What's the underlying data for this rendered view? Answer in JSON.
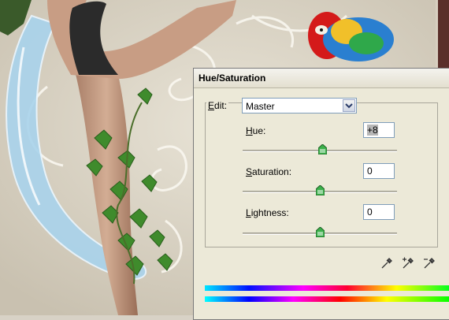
{
  "dialog": {
    "title": "Hue/Saturation",
    "edit": {
      "label_prefix": "",
      "label_hotkey": "E",
      "label_rest": "dit:",
      "selected": "Master"
    },
    "fields": [
      {
        "key": "hue",
        "hotkey": "H",
        "rest": "ue:",
        "value": "+8",
        "slider_fraction": 0.52
      },
      {
        "key": "saturation",
        "hotkey": "S",
        "rest": "aturation:",
        "value": "0",
        "slider_fraction": 0.5
      },
      {
        "key": "lightness",
        "hotkey": "L",
        "rest": "ightness:",
        "value": "0",
        "slider_fraction": 0.5
      }
    ],
    "eyedroppers": [
      "eyedropper-icon",
      "eyedropper-plus-icon",
      "eyedropper-minus-icon"
    ]
  },
  "colors": {
    "slider_thumb": "#3bb04a",
    "select_border": "#7f9db9",
    "dialog_bg": "#ece9d8"
  }
}
